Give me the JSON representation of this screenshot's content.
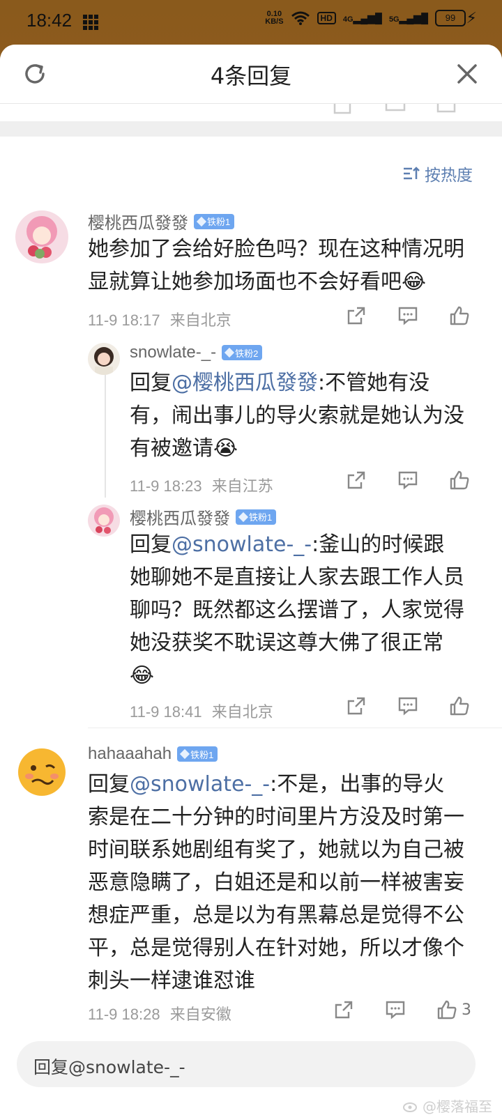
{
  "status_bar": {
    "time": "18:42",
    "net_speed_value": "0.10",
    "net_speed_unit": "KB/S",
    "hd_label": "HD",
    "signal1_label": "4G",
    "signal2_label": "5G",
    "battery": "99"
  },
  "header": {
    "title": "4条回复",
    "refresh_icon": "refresh-icon",
    "close_icon": "close-icon"
  },
  "sort": {
    "label": "按热度",
    "icon": "sort-icon"
  },
  "comments": [
    {
      "user": "樱桃西瓜發發",
      "badge": "铁粉1",
      "text": "她参加了会给好脸色吗？现在这种情况明显就算让她参加场面也不会好看吧",
      "time": "11-9 18:17",
      "location": "来自北京"
    },
    {
      "user": "snowlate-_-",
      "badge": "铁粉2",
      "reply_prefix": "回复",
      "mention": "@樱桃西瓜發發",
      "text": ":不管她有没有，闹出事儿的导火索就是她认为没有被邀请",
      "time": "11-9 18:23",
      "location": "来自江苏"
    },
    {
      "user": "樱桃西瓜發發",
      "badge": "铁粉1",
      "reply_prefix": "回复",
      "mention": "@snowlate-_-",
      "text": ":釜山的时候跟她聊她不是直接让人家去跟工作人员聊吗？既然都这么摆谱了，人家觉得她没获奖不耽误这尊大佛了很正常",
      "time": "11-9 18:41",
      "location": "来自北京"
    },
    {
      "user": "hahaaahah",
      "badge": "铁粉1",
      "reply_prefix": "回复",
      "mention": "@snowlate-_-",
      "text": ":不是，出事的导火索是在二十分钟的时间里片方没及时第一时间联系她剧组有奖了，她就以为自己被恶意隐瞒了，白姐还是和以前一样被害妄想症严重，总是以为有黑幕总是觉得不公平，总是觉得别人在针对她，所以才像个刺头一样逮谁怼谁",
      "time": "11-9 18:28",
      "location": "来自安徽",
      "likes": "3"
    }
  ],
  "reply_input": {
    "placeholder": "回复@snowlate-_-"
  },
  "watermark": "@樱落福至",
  "colors": {
    "link": "#4d6fa4",
    "badge": "#6ea6f0",
    "sort": "#5d7fb1"
  }
}
